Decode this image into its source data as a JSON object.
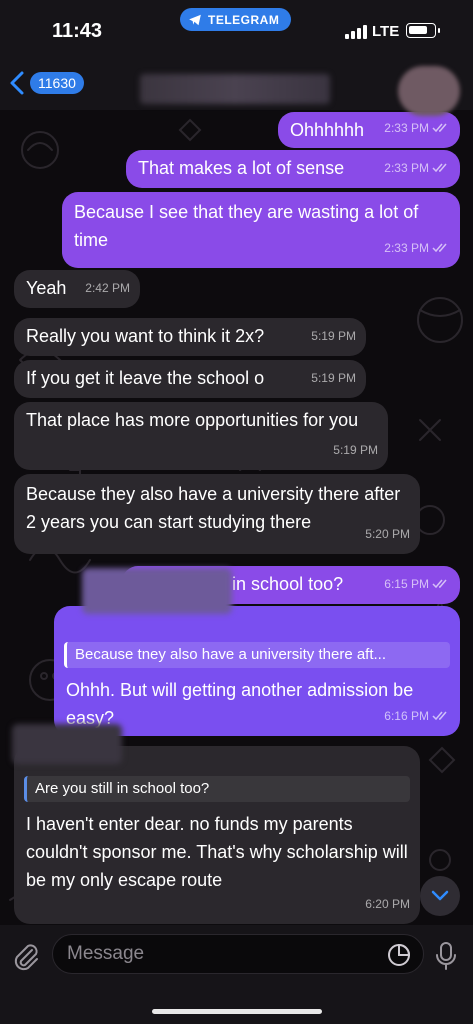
{
  "status_bar": {
    "time": "11:43",
    "app_pill": "TELEGRAM",
    "network": "LTE"
  },
  "header": {
    "unread_count": "11630"
  },
  "messages": [
    {
      "dir": "out",
      "text": "Ohhhhhh",
      "time": "2:33 PM"
    },
    {
      "dir": "out",
      "text": "That makes a lot of sense",
      "time": "2:33 PM"
    },
    {
      "dir": "out",
      "text": "Because I see that they are wasting a lot of time",
      "time": "2:33 PM"
    },
    {
      "dir": "in",
      "text": "Yeah",
      "time": "2:42 PM"
    },
    {
      "dir": "in",
      "text": "Really you want to think it 2x?",
      "time": "5:19 PM"
    },
    {
      "dir": "in",
      "text": "If you get it leave the school o",
      "time": "5:19 PM"
    },
    {
      "dir": "in",
      "text": "That place has more opportunities for you",
      "time": "5:19 PM"
    },
    {
      "dir": "in",
      "text": "Because they also have a university there after 2 years you can start studying there",
      "time": "5:20 PM"
    },
    {
      "dir": "out",
      "text": "Are you still in school too?",
      "time": "6:15 PM"
    },
    {
      "dir": "out",
      "reply": "Because tney also have a university there aft...",
      "text": "Ohhh. But will getting another admission be easy?",
      "time": "6:16 PM"
    },
    {
      "dir": "in",
      "reply": "Are you still in school too?",
      "text": "I haven't enter dear.  no funds my parents couldn't sponsor me. That's why scholarship will be my only escape route",
      "time": "6:20 PM"
    }
  ],
  "input": {
    "placeholder": "Message"
  },
  "icons": {
    "back": "chevron-left-icon",
    "telegram": "telegram-plane-icon",
    "attach": "paperclip-icon",
    "sticker": "sticker-icon",
    "mic": "microphone-icon",
    "scroll": "chevron-down-icon",
    "read": "double-check-icon"
  },
  "colors": {
    "outgoing_bubble": "#8a4be8",
    "incoming_bubble": "#2b282d",
    "accent": "#2f7ce8",
    "background": "#0d0b0e"
  }
}
